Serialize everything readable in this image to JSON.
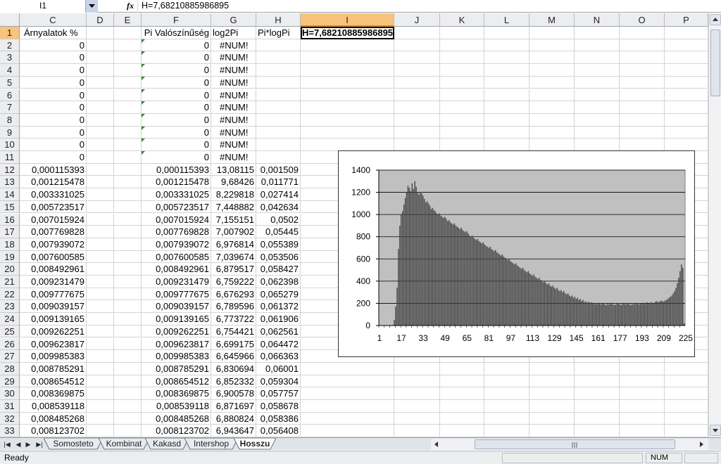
{
  "formula_bar": {
    "name_box": "I1",
    "fx_label": "fx",
    "formula": "H=7,68210885986895"
  },
  "columns": [
    {
      "label": "C",
      "active": false
    },
    {
      "label": "D",
      "active": false
    },
    {
      "label": "E",
      "active": false
    },
    {
      "label": "F",
      "active": false
    },
    {
      "label": "G",
      "active": false
    },
    {
      "label": "H",
      "active": false
    },
    {
      "label": "I",
      "active": true
    },
    {
      "label": "J",
      "active": false
    },
    {
      "label": "K",
      "active": false
    },
    {
      "label": "L",
      "active": false
    },
    {
      "label": "M",
      "active": false
    },
    {
      "label": "N",
      "active": false
    },
    {
      "label": "O",
      "active": false
    },
    {
      "label": "P",
      "active": false
    }
  ],
  "headers": {
    "C": "Árnyalatok %",
    "F": "Pi Valószínűség",
    "G": "log2Pi",
    "H": "Pi*logPi",
    "I": "H=7,68210885986895"
  },
  "rows": [
    {
      "n": "2",
      "C": "0",
      "F": "0",
      "G": "#NUM!",
      "H": ""
    },
    {
      "n": "3",
      "C": "0",
      "F": "0",
      "G": "#NUM!",
      "H": ""
    },
    {
      "n": "4",
      "C": "0",
      "F": "0",
      "G": "#NUM!",
      "H": ""
    },
    {
      "n": "5",
      "C": "0",
      "F": "0",
      "G": "#NUM!",
      "H": ""
    },
    {
      "n": "6",
      "C": "0",
      "F": "0",
      "G": "#NUM!",
      "H": ""
    },
    {
      "n": "7",
      "C": "0",
      "F": "0",
      "G": "#NUM!",
      "H": ""
    },
    {
      "n": "8",
      "C": "0",
      "F": "0",
      "G": "#NUM!",
      "H": ""
    },
    {
      "n": "9",
      "C": "0",
      "F": "0",
      "G": "#NUM!",
      "H": ""
    },
    {
      "n": "10",
      "C": "0",
      "F": "0",
      "G": "#NUM!",
      "H": ""
    },
    {
      "n": "11",
      "C": "0",
      "F": "0",
      "G": "#NUM!",
      "H": ""
    },
    {
      "n": "12",
      "C": "0,000115393",
      "F": "0,000115393",
      "G": "13,08115",
      "H": "0,001509"
    },
    {
      "n": "13",
      "C": "0,001215478",
      "F": "0,001215478",
      "G": "9,68426",
      "H": "0,011771"
    },
    {
      "n": "14",
      "C": "0,003331025",
      "F": "0,003331025",
      "G": "8,229818",
      "H": "0,027414"
    },
    {
      "n": "15",
      "C": "0,005723517",
      "F": "0,005723517",
      "G": "7,448882",
      "H": "0,042634"
    },
    {
      "n": "16",
      "C": "0,007015924",
      "F": "0,007015924",
      "G": "7,155151",
      "H": "0,0502"
    },
    {
      "n": "17",
      "C": "0,007769828",
      "F": "0,007769828",
      "G": "7,007902",
      "H": "0,05445"
    },
    {
      "n": "18",
      "C": "0,007939072",
      "F": "0,007939072",
      "G": "6,976814",
      "H": "0,055389"
    },
    {
      "n": "19",
      "C": "0,007600585",
      "F": "0,007600585",
      "G": "7,039674",
      "H": "0,053506"
    },
    {
      "n": "20",
      "C": "0,008492961",
      "F": "0,008492961",
      "G": "6,879517",
      "H": "0,058427"
    },
    {
      "n": "21",
      "C": "0,009231479",
      "F": "0,009231479",
      "G": "6,759222",
      "H": "0,062398"
    },
    {
      "n": "22",
      "C": "0,009777675",
      "F": "0,009777675",
      "G": "6,676293",
      "H": "0,065279"
    },
    {
      "n": "23",
      "C": "0,009039157",
      "F": "0,009039157",
      "G": "6,789596",
      "H": "0,061372"
    },
    {
      "n": "24",
      "C": "0,009139165",
      "F": "0,009139165",
      "G": "6,773722",
      "H": "0,061906"
    },
    {
      "n": "25",
      "C": "0,009262251",
      "F": "0,009262251",
      "G": "6,754421",
      "H": "0,062561"
    },
    {
      "n": "26",
      "C": "0,009623817",
      "F": "0,009623817",
      "G": "6,699175",
      "H": "0,064472"
    },
    {
      "n": "27",
      "C": "0,009985383",
      "F": "0,009985383",
      "G": "6,645966",
      "H": "0,066363"
    },
    {
      "n": "28",
      "C": "0,008785291",
      "F": "0,008785291",
      "G": "6,830694",
      "H": "0,06001"
    },
    {
      "n": "29",
      "C": "0,008654512",
      "F": "0,008654512",
      "G": "6,852332",
      "H": "0,059304"
    },
    {
      "n": "30",
      "C": "0,008369875",
      "F": "0,008369875",
      "G": "6,900578",
      "H": "0,057757"
    },
    {
      "n": "31",
      "C": "0,008539118",
      "F": "0,008539118",
      "G": "6,871697",
      "H": "0,058678"
    },
    {
      "n": "32",
      "C": "0,008485268",
      "F": "0,008485268",
      "G": "6,880824",
      "H": "0,058386"
    },
    {
      "n": "33",
      "C": "0,008123702",
      "F": "0,008123702",
      "G": "6,943647",
      "H": "0,056408"
    }
  ],
  "chart_data": {
    "type": "bar",
    "ylim": [
      0,
      1400
    ],
    "yticks": [
      0,
      200,
      400,
      600,
      800,
      1000,
      1200,
      1400
    ],
    "xticks": [
      "1",
      "17",
      "33",
      "49",
      "65",
      "81",
      "97",
      "113",
      "129",
      "145",
      "161",
      "177",
      "193",
      "209",
      "225",
      "241"
    ],
    "grid": true,
    "legend": "none",
    "plot_color": "#c0c0c0",
    "bar_color": "#404040",
    "x": [
      1,
      256
    ],
    "values": [
      0,
      0,
      0,
      0,
      0,
      0,
      0,
      0,
      0,
      0,
      5,
      50,
      170,
      340,
      690,
      900,
      1000,
      1030,
      1090,
      1150,
      1200,
      1260,
      1240,
      1210,
      1280,
      1230,
      1300,
      1250,
      1200,
      1180,
      1200,
      1190,
      1170,
      1140,
      1110,
      1120,
      1100,
      1080,
      1050,
      1060,
      1040,
      1030,
      1010,
      1000,
      1010,
      990,
      980,
      970,
      980,
      960,
      940,
      950,
      930,
      920,
      910,
      920,
      900,
      890,
      880,
      870,
      880,
      860,
      850,
      840,
      850,
      830,
      810,
      800,
      810,
      790,
      780,
      770,
      780,
      760,
      750,
      740,
      750,
      730,
      720,
      710,
      700,
      710,
      690,
      680,
      670,
      680,
      660,
      650,
      640,
      630,
      640,
      620,
      610,
      600,
      590,
      600,
      580,
      570,
      560,
      550,
      560,
      540,
      530,
      520,
      510,
      520,
      500,
      490,
      480,
      490,
      470,
      460,
      450,
      460,
      440,
      430,
      420,
      430,
      410,
      400,
      390,
      400,
      380,
      370,
      380,
      360,
      350,
      360,
      340,
      330,
      340,
      320,
      310,
      320,
      300,
      310,
      290,
      280,
      290,
      270,
      260,
      270,
      250,
      260,
      240,
      250,
      230,
      240,
      220,
      230,
      210,
      220,
      205,
      215,
      200,
      210,
      195,
      205,
      190,
      200,
      195,
      200,
      190,
      195,
      200,
      190,
      185,
      195,
      190,
      200,
      195,
      190,
      185,
      190,
      195,
      200,
      190,
      185,
      195,
      200,
      190,
      195,
      200,
      190,
      185,
      195,
      190,
      200,
      195,
      200,
      190,
      195,
      200,
      205,
      195,
      200,
      210,
      200,
      205,
      210,
      200,
      205,
      215,
      220,
      210,
      215,
      225,
      220,
      215,
      225,
      230,
      240,
      250,
      260,
      270,
      290,
      310,
      340,
      380,
      430,
      490,
      550,
      520,
      20
    ]
  },
  "sheet_tabs": {
    "nav": [
      "|◀",
      "◀",
      "▶",
      "▶|"
    ],
    "tabs": [
      "Somosteto",
      "Kombinat",
      "Kakasd",
      "Intershop",
      "Hosszu"
    ],
    "active": "Hosszu"
  },
  "status": {
    "text": "Ready",
    "num": "NUM"
  }
}
